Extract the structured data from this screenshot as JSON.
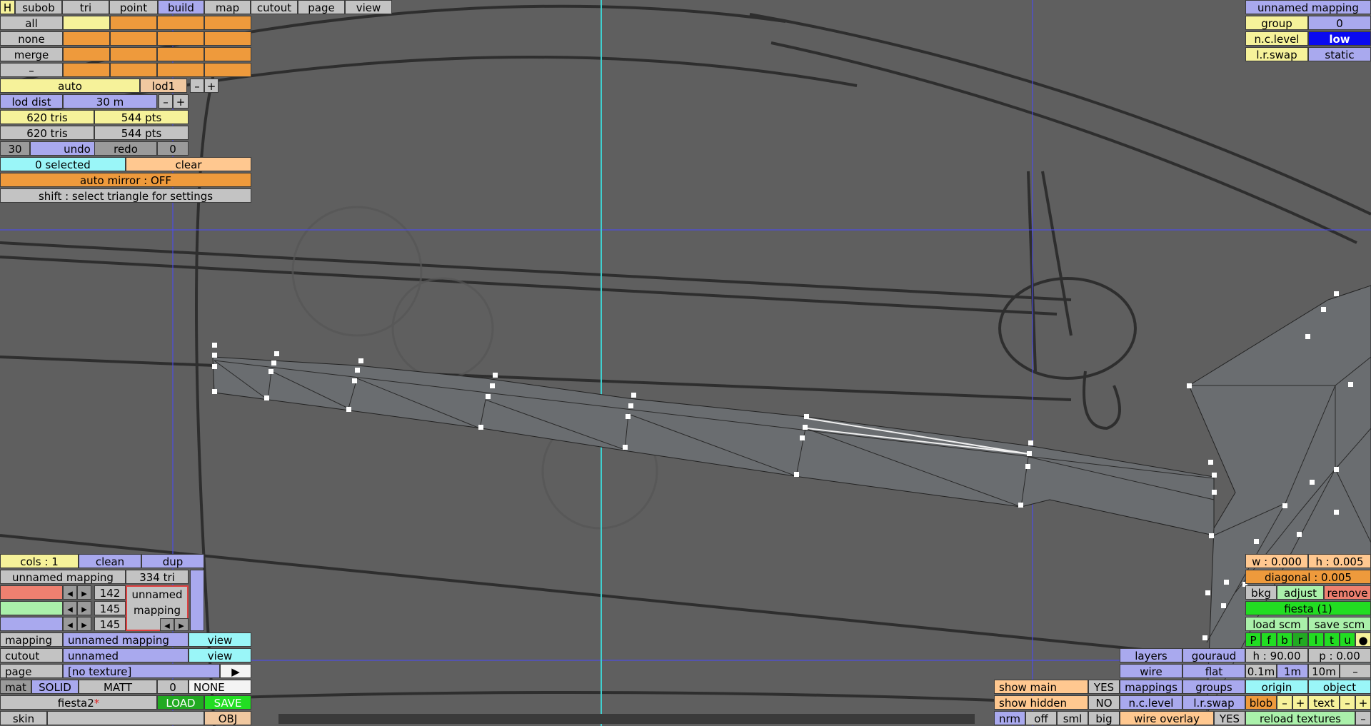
{
  "top_tabs": [
    "H",
    "subob",
    "tri",
    "point",
    "build",
    "map",
    "cutout",
    "page",
    "view"
  ],
  "select_rows": [
    "all",
    "none",
    "merge",
    "–"
  ],
  "lod": {
    "auto": "auto",
    "lod": "lod1",
    "minus": "–",
    "plus": "+",
    "dist_label": "lod dist",
    "dist_value": "30 m"
  },
  "stats": {
    "tris1": "620 tris",
    "pts1": "544 pts",
    "tris2": "620 tris",
    "pts2": "544 pts"
  },
  "undo_row": {
    "count": "30",
    "undo": "undo",
    "redo": "redo",
    "redo_count": "0"
  },
  "selection": {
    "selected": "0 selected",
    "clear": "clear"
  },
  "mirror": "auto mirror : OFF",
  "hint": "shift : select triangle for settings",
  "mapping_panel": {
    "title": "unnamed mapping",
    "group_label": "group",
    "group_value": "0",
    "nclevel_label": "n.c.level",
    "nclevel_value": "low",
    "lrswap_label": "l.r.swap",
    "lrswap_value": "static"
  },
  "cols": {
    "cols": "cols : 1",
    "clean": "clean",
    "dup": "dup"
  },
  "mapping_info": {
    "name": "unnamed mapping",
    "tri": "334 tri",
    "r": "142",
    "g": "145",
    "b": "145",
    "preview": "unnamed mapping"
  },
  "bottom_left": {
    "mapping_label": "mapping",
    "mapping_value": "unnamed mapping",
    "view": "view",
    "cutout_label": "cutout",
    "cutout_value": "unnamed",
    "page_label": "page",
    "page_value": "[no texture]",
    "mat": "mat",
    "solid": "SOLID",
    "matt": "MATT",
    "mat_num": "0",
    "mat_none": "NONE",
    "file": "fiesta2",
    "modified": "*",
    "load": "LOAD",
    "save": "SAVE",
    "skin": "skin",
    "obj": "OBJ"
  },
  "right_bottom": {
    "w": "w : 0.000",
    "h": "h : 0.005",
    "diagonal": "diagonal : 0.005",
    "bkg": "bkg",
    "adjust": "adjust",
    "remove": "remove",
    "fiesta": "fiesta (1)",
    "load_scm": "load scm",
    "save_scm": "save scm",
    "views": [
      "P",
      "f",
      "b",
      "r",
      "l",
      "t",
      "u",
      "●"
    ],
    "hrot": "h : 90.00",
    "prot": "p : 0.00",
    "grid": [
      "0.1m",
      "1m",
      "10m",
      "–"
    ],
    "origin": "origin",
    "object": "object",
    "blob": "blob",
    "text": "text",
    "minus": "–",
    "plus": "+",
    "reload": "reload textures"
  },
  "render_panel": {
    "layers": "layers",
    "gouraud": "gouraud",
    "wire": "wire",
    "flat": "flat",
    "mappings": "mappings",
    "groups": "groups",
    "nclevel": "n.c.level",
    "lrswap": "l.r.swap",
    "wire_overlay": "wire overlay",
    "wire_overlay_val": "YES"
  },
  "show_panel": {
    "show_main": "show main",
    "show_main_val": "YES",
    "show_hidden": "show hidden",
    "show_hidden_val": "NO",
    "modes": [
      "nrm",
      "off",
      "sml",
      "big"
    ]
  },
  "colors": {
    "viewport": "#5f5f5f",
    "mesh": "#6a6d70",
    "guide_blue": "#4a4aff",
    "guide_cyan": "#3fd0d0"
  }
}
